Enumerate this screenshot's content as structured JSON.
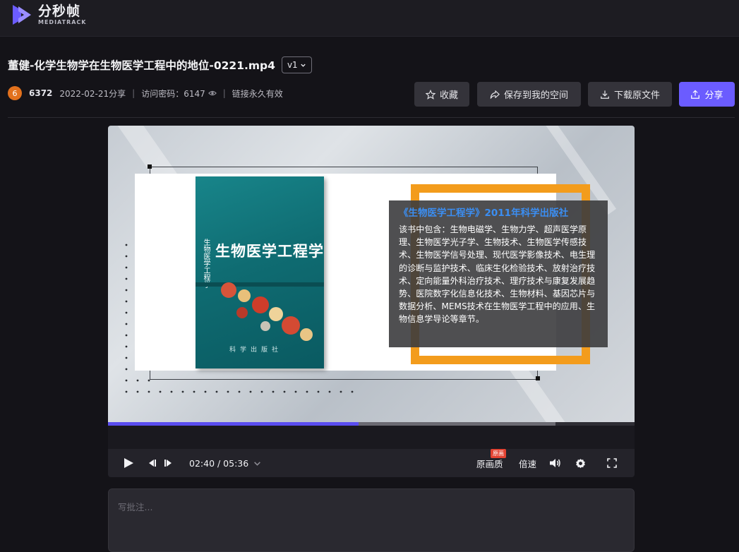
{
  "app": {
    "name": "分秒帧",
    "subtitle": "MEDIATRACK"
  },
  "file": {
    "title": "董健-化学生物学在生物医学工程中的地位-0221.mp4",
    "version": "v1"
  },
  "meta": {
    "avatar_letter": "6",
    "owner": "6372",
    "shared_date": "2022-02-21分享",
    "access_code_label": "访问密码：6147",
    "link_validity": "链接永久有效"
  },
  "actions": {
    "favorite": "收藏",
    "save_to_space": "保存到我的空间",
    "download": "下载原文件",
    "share": "分享"
  },
  "video_frame": {
    "book_title": "生物医学工程学",
    "book_spine": "生物医学工程学",
    "book_publisher": "科学出版社",
    "info_heading": "《生物医学工程学》2011年科学出版社",
    "info_body": "该书中包含：生物电磁学、生物力学、超声医学原理、生物医学光子学、生物技术、生物医学传感技术、生物医学信号处理、现代医学影像技术、电生理的诊断与监护技术、临床生化检验技术、放射治疗技术、定向能量外科治疗技术、理疗技术与康复发展趋势、医院数字化信息化技术、生物材料、基因芯片与数据分析、MEMS技术在生物医学工程中的应用、生物信息学导论等章节。"
  },
  "player": {
    "time": "02:40 / 05:36",
    "progress_fraction": 0.476,
    "buffered_fraction": 0.85,
    "quality_label": "原画质",
    "quality_badge": "原画",
    "speed_label": "倍速"
  },
  "comment": {
    "placeholder": "写批注..."
  },
  "colors": {
    "accent": "#6b5cff",
    "progress": "#5a4df0",
    "avatar": "#e2711d",
    "frame": "#f39c1c"
  },
  "icons": [
    "logo-icon",
    "chevron-down-icon",
    "eye-icon",
    "star-icon",
    "share-arrow-icon",
    "download-icon",
    "export-icon",
    "play-icon",
    "prev-frame-icon",
    "next-frame-icon",
    "volume-icon",
    "settings-icon",
    "fullscreen-icon"
  ]
}
